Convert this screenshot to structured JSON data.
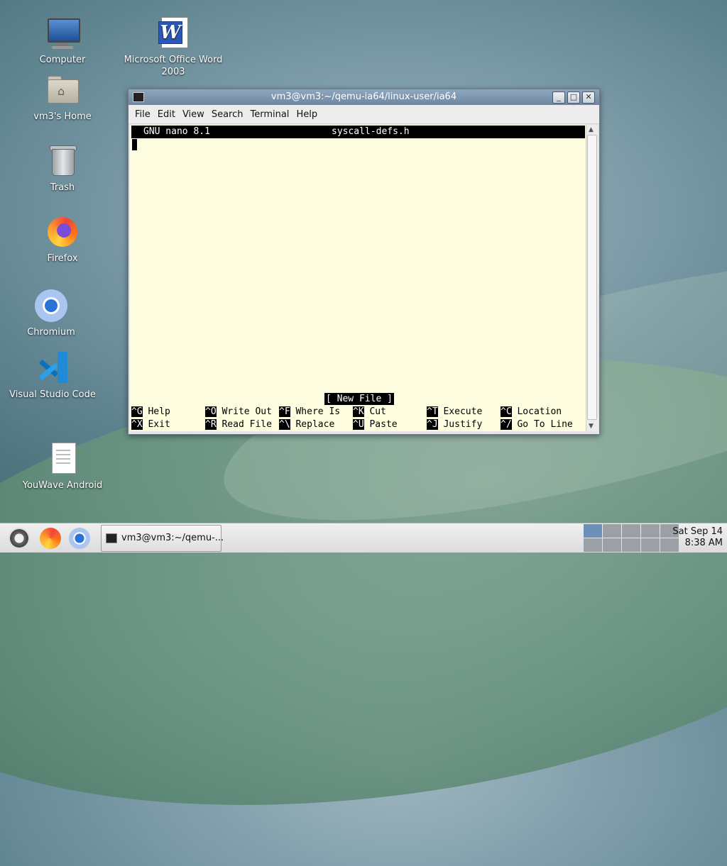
{
  "desktop": {
    "icons": [
      {
        "label": "Computer",
        "icon": "computer-icon"
      },
      {
        "label": "Microsoft Office Word\n2003",
        "icon": "word-icon"
      },
      {
        "label": "vm3's Home",
        "icon": "home-folder-icon"
      },
      {
        "label": "Trash",
        "icon": "trash-icon"
      },
      {
        "label": "Firefox",
        "icon": "firefox-icon"
      },
      {
        "label": "Chromium",
        "icon": "chromium-icon"
      },
      {
        "label": "Visual Studio Code",
        "icon": "vscode-icon"
      },
      {
        "label": "YouWave Android",
        "icon": "document-icon"
      }
    ]
  },
  "window": {
    "title": "vm3@vm3:~/qemu-ia64/linux-user/ia64",
    "buttons": {
      "minimize": "_",
      "maximize": "□",
      "close": "✕"
    },
    "menu": [
      "File",
      "Edit",
      "View",
      "Search",
      "Terminal",
      "Help"
    ]
  },
  "nano": {
    "version": "GNU nano 8.1",
    "filename": "syscall-defs.h",
    "status": "[ New File ]",
    "shortcuts_row1": [
      {
        "key": "^G",
        "label": "Help"
      },
      {
        "key": "^O",
        "label": "Write Out"
      },
      {
        "key": "^F",
        "label": "Where Is"
      },
      {
        "key": "^K",
        "label": "Cut"
      },
      {
        "key": "^T",
        "label": "Execute"
      },
      {
        "key": "^C",
        "label": "Location"
      }
    ],
    "shortcuts_row2": [
      {
        "key": "^X",
        "label": "Exit"
      },
      {
        "key": "^R",
        "label": "Read File"
      },
      {
        "key": "^\\",
        "label": "Replace"
      },
      {
        "key": "^U",
        "label": "Paste"
      },
      {
        "key": "^J",
        "label": "Justify"
      },
      {
        "key": "^/",
        "label": "Go To Line"
      }
    ]
  },
  "taskbar": {
    "task_label": "vm3@vm3:~/qemu-...",
    "date": "Sat Sep 14",
    "time": "8:38 AM"
  }
}
